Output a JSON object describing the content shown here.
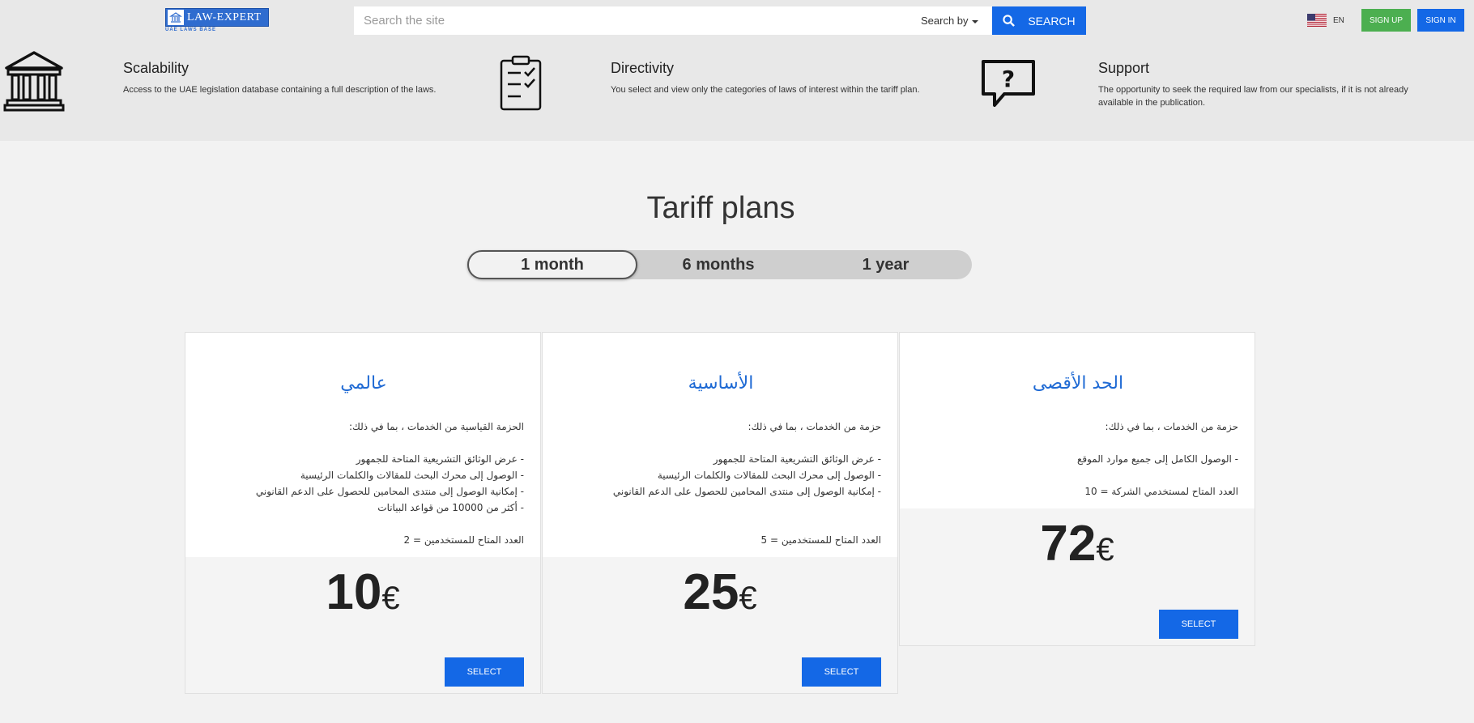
{
  "header": {
    "logo_text": "LAW-EXPERT",
    "logo_sub": "UAE LAWS BASE",
    "search_placeholder": "Search the site",
    "search_by": "Search by",
    "search_button": "SEARCH",
    "lang": "EN",
    "sign_up": "SIGN UP",
    "sign_in": "SIGN IN"
  },
  "features": [
    {
      "title": "Scalability",
      "desc": "Access to the UAE legislation database containing a full description of the laws.",
      "icon": "courthouse-icon"
    },
    {
      "title": "Directivity",
      "desc": "You select and view only the categories of laws of interest within the tariff plan.",
      "icon": "checklist-icon"
    },
    {
      "title": "Support",
      "desc": "The opportunity to seek the required law from our specialists, if it is not already available in the publication.",
      "icon": "question-bubble-icon"
    }
  ],
  "tariff": {
    "title": "Tariff plans",
    "periods": [
      "1 month",
      "6 months",
      "1 year"
    ],
    "active_period": "1 month",
    "plans": [
      {
        "name": "عالمي",
        "intro": "الحزمة القياسية من الخدمات ، بما في ذلك:",
        "items": [
          "- عرض الوثائق التشريعية المتاحة للجمهور",
          "- الوصول إلى محرك البحث للمقالات والكلمات الرئيسية",
          "- إمكانية الوصول إلى منتدى المحامين للحصول على الدعم القانوني",
          "- أكثر من 10000 من قواعد البيانات"
        ],
        "users": "العدد المتاح للمستخدمين = 2",
        "price": "10",
        "currency": "€",
        "select": "SELECT"
      },
      {
        "name": "الأساسية",
        "intro": "حزمة من الخدمات ، بما في ذلك:",
        "items": [
          "- عرض الوثائق التشريعية المتاحة للجمهور",
          "- الوصول إلى محرك البحث للمقالات والكلمات الرئيسية",
          "- إمكانية الوصول إلى منتدى المحامين للحصول على الدعم القانوني"
        ],
        "users": "العدد المتاح للمستخدمين = 5",
        "price": "25",
        "currency": "€",
        "select": "SELECT"
      },
      {
        "name": "الحد الأقصى",
        "intro": "حزمة من الخدمات ، بما في ذلك:",
        "items": [
          "- الوصول الكامل إلى جميع موارد الموقع"
        ],
        "users": "العدد المتاح لمستخدمي الشركة = 10",
        "price": "72",
        "currency": "€",
        "select": "SELECT"
      }
    ]
  },
  "colors": {
    "accent": "#1468e6",
    "signup": "#4caf50",
    "plan_name": "#1f6ad4"
  }
}
